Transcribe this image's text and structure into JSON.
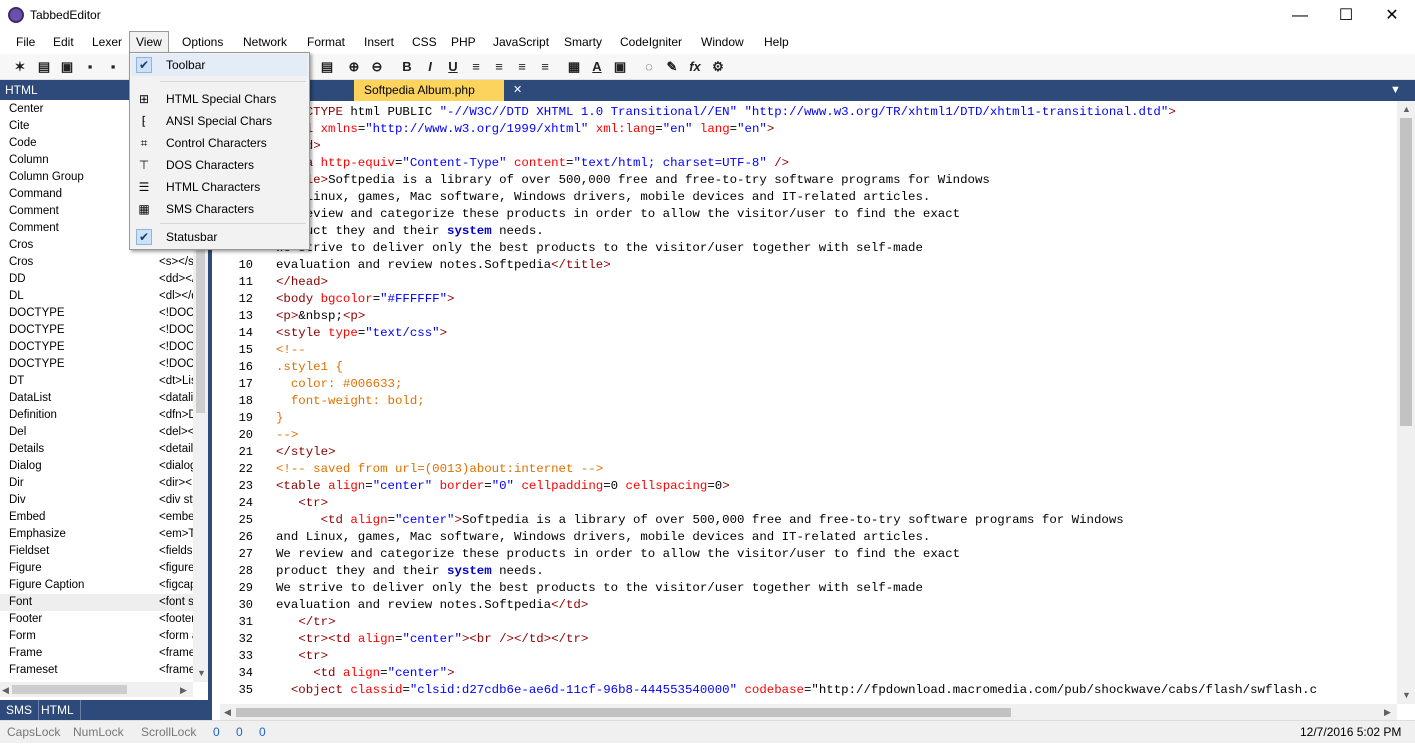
{
  "app": {
    "title": "TabbedEditor"
  },
  "window": {
    "minimize": "—",
    "maximize": "☐",
    "close": "✕"
  },
  "menu": [
    "File",
    "Edit",
    "Lexer",
    "View",
    "Options",
    "Network",
    "Format",
    "Insert",
    "CSS",
    "PHP",
    "JavaScript",
    "Smarty",
    "CodeIgniter",
    "Window",
    "Help"
  ],
  "toolbar_icons": {
    "new": "✶",
    "open": "▤",
    "close": "▣",
    "save": "▪",
    "saveall": "▪",
    "zoomin": "⊕",
    "zoomout": "⊖",
    "bold": "B",
    "italic": "I",
    "underline": "U",
    "align-left": "≡",
    "align-center": "≡",
    "align-right": "≡",
    "justify": "≡",
    "table": "▦",
    "font": "A",
    "image": "▣",
    "comment": "◌",
    "special": "✎",
    "fx": "fx",
    "tag": "⚙"
  },
  "left_panel": {
    "header": "HTML",
    "rows": [
      {
        "name": "Center",
        "value": ""
      },
      {
        "name": "Cite",
        "value": ""
      },
      {
        "name": "Code",
        "value": ""
      },
      {
        "name": "Column",
        "value": ""
      },
      {
        "name": "Column Group",
        "value": ""
      },
      {
        "name": "Command",
        "value": ""
      },
      {
        "name": "Comment",
        "value": ""
      },
      {
        "name": "Comment",
        "value": ""
      },
      {
        "name": "Cros",
        "value": ""
      },
      {
        "name": "Cros",
        "value": "<s></s"
      },
      {
        "name": "DD",
        "value": "<dd></"
      },
      {
        "name": "DL",
        "value": "<dl></dl"
      },
      {
        "name": "DOCTYPE",
        "value": "<!DOC"
      },
      {
        "name": "DOCTYPE",
        "value": "<!DOC"
      },
      {
        "name": "DOCTYPE",
        "value": "<!DOC"
      },
      {
        "name": "DOCTYPE",
        "value": "<!DOC"
      },
      {
        "name": "DT",
        "value": "<dt>Lis"
      },
      {
        "name": "DataList",
        "value": "<datalis"
      },
      {
        "name": "Definition",
        "value": "<dfn>D"
      },
      {
        "name": "Del",
        "value": "<del><"
      },
      {
        "name": "Details",
        "value": "<details"
      },
      {
        "name": "Dialog",
        "value": "<dialog"
      },
      {
        "name": "Dir",
        "value": "<dir><"
      },
      {
        "name": "Div",
        "value": "<div sty"
      },
      {
        "name": "Embed",
        "value": "<embe"
      },
      {
        "name": "Emphasize",
        "value": "<em>T"
      },
      {
        "name": "Fieldset",
        "value": "<fields"
      },
      {
        "name": "Figure",
        "value": "<figure"
      },
      {
        "name": "Figure Caption",
        "value": "<figcap"
      },
      {
        "name": "Font",
        "value": "<font s"
      },
      {
        "name": "Footer",
        "value": "<footer"
      },
      {
        "name": "Form",
        "value": "<form a"
      },
      {
        "name": "Frame",
        "value": "<frame"
      },
      {
        "name": "Frameset",
        "value": "<frame"
      }
    ],
    "tabs": [
      "SMS",
      "HTML"
    ]
  },
  "editor": {
    "tab_label": "Softpedia Album.php",
    "tab_close": "✕",
    "tab_menu": "▼",
    "line_numbers": [
      "",
      "",
      "",
      "",
      "",
      "",
      "",
      "",
      "",
      "10",
      "11",
      "12",
      "13",
      "14",
      "15",
      "16",
      "17",
      "18",
      "19",
      "20",
      "21",
      "22",
      "23",
      "24",
      "25",
      "26",
      "27",
      "28",
      "29",
      "30",
      "31",
      "32",
      "33",
      "34",
      "35"
    ],
    "lines": [
      "<!DOCTYPE html PUBLIC \"-//W3C//DTD XHTML 1.0 Transitional//EN\" \"http://www.w3.org/TR/xhtml1/DTD/xhtml1-transitional.dtd\">",
      "<html xmlns=\"http://www.w3.org/1999/xhtml\" xml:lang=\"en\" lang=\"en\">",
      "<head>",
      "<meta http-equiv=\"Content-Type\" content=\"text/html; charset=UTF-8\" />",
      "<title>Softpedia is a library of over 500,000 free and free-to-try software programs for Windows",
      "and Linux, games, Mac software, Windows drivers, mobile devices and IT-related articles.",
      "We review and categorize these products in order to allow the visitor/user to find the exact",
      "product they and their system needs.",
      "We strive to deliver only the best products to the visitor/user together with self-made",
      "evaluation and review notes.Softpedia</title>",
      "</head>",
      "<body bgcolor=\"#FFFFFF\">",
      "<p>&nbsp;<p>",
      "<style type=\"text/css\">",
      "<!--",
      ".style1 {",
      "  color: #006633;",
      "  font-weight: bold;",
      "}",
      "-->",
      "</style>",
      "<!-- saved from url=(0013)about:internet -->",
      "<table align=\"center\" border=\"0\" cellpadding=0 cellspacing=0>",
      "   <tr>",
      "      <td align=\"center\">Softpedia is a library of over 500,000 free and free-to-try software programs for Windows",
      "and Linux, games, Mac software, Windows drivers, mobile devices and IT-related articles.",
      "We review and categorize these products in order to allow the visitor/user to find the exact",
      "product they and their system needs.",
      "We strive to deliver only the best products to the visitor/user together with self-made",
      "evaluation and review notes.Softpedia</td>",
      "   </tr>",
      "   <tr><td align=\"center\"><br /></td></tr>",
      "   <tr>",
      "     <td align=\"center\">",
      "  <object classid=\"clsid:d27cdb6e-ae6d-11cf-96b8-444553540000\" codebase=\"http://fpdownload.macromedia.com/pub/shockwave/cabs/flash/swflash.c"
    ]
  },
  "view_menu": {
    "items": [
      {
        "label": "Toolbar",
        "icon": "✔",
        "checked": true
      },
      {
        "label": "HTML Special Chars",
        "icon": "⊞",
        "checked": false
      },
      {
        "label": "ANSI Special Chars",
        "icon": "⁅",
        "checked": false
      },
      {
        "label": "Control Characters",
        "icon": "⌗",
        "checked": false
      },
      {
        "label": "DOS Characters",
        "icon": "⊤",
        "checked": false
      },
      {
        "label": "HTML Characters",
        "icon": "☰",
        "checked": false
      },
      {
        "label": "SMS Characters",
        "icon": "▦",
        "checked": false
      },
      {
        "label": "Statusbar",
        "icon": "✔",
        "checked": true
      }
    ]
  },
  "statusbar": {
    "caps": "CapsLock",
    "num": "NumLock",
    "scroll": "ScrollLock",
    "v1": "0",
    "v2": "0",
    "v3": "0",
    "datetime": "12/7/2016 5:02 PM"
  },
  "colors": {
    "accent": "#2d4a7a",
    "tab": "#fcd35c",
    "tag": "#8b0000",
    "attr": "#ff0000",
    "value": "#0000ff",
    "comment": "#e07000",
    "keyword": "#0000c8"
  }
}
